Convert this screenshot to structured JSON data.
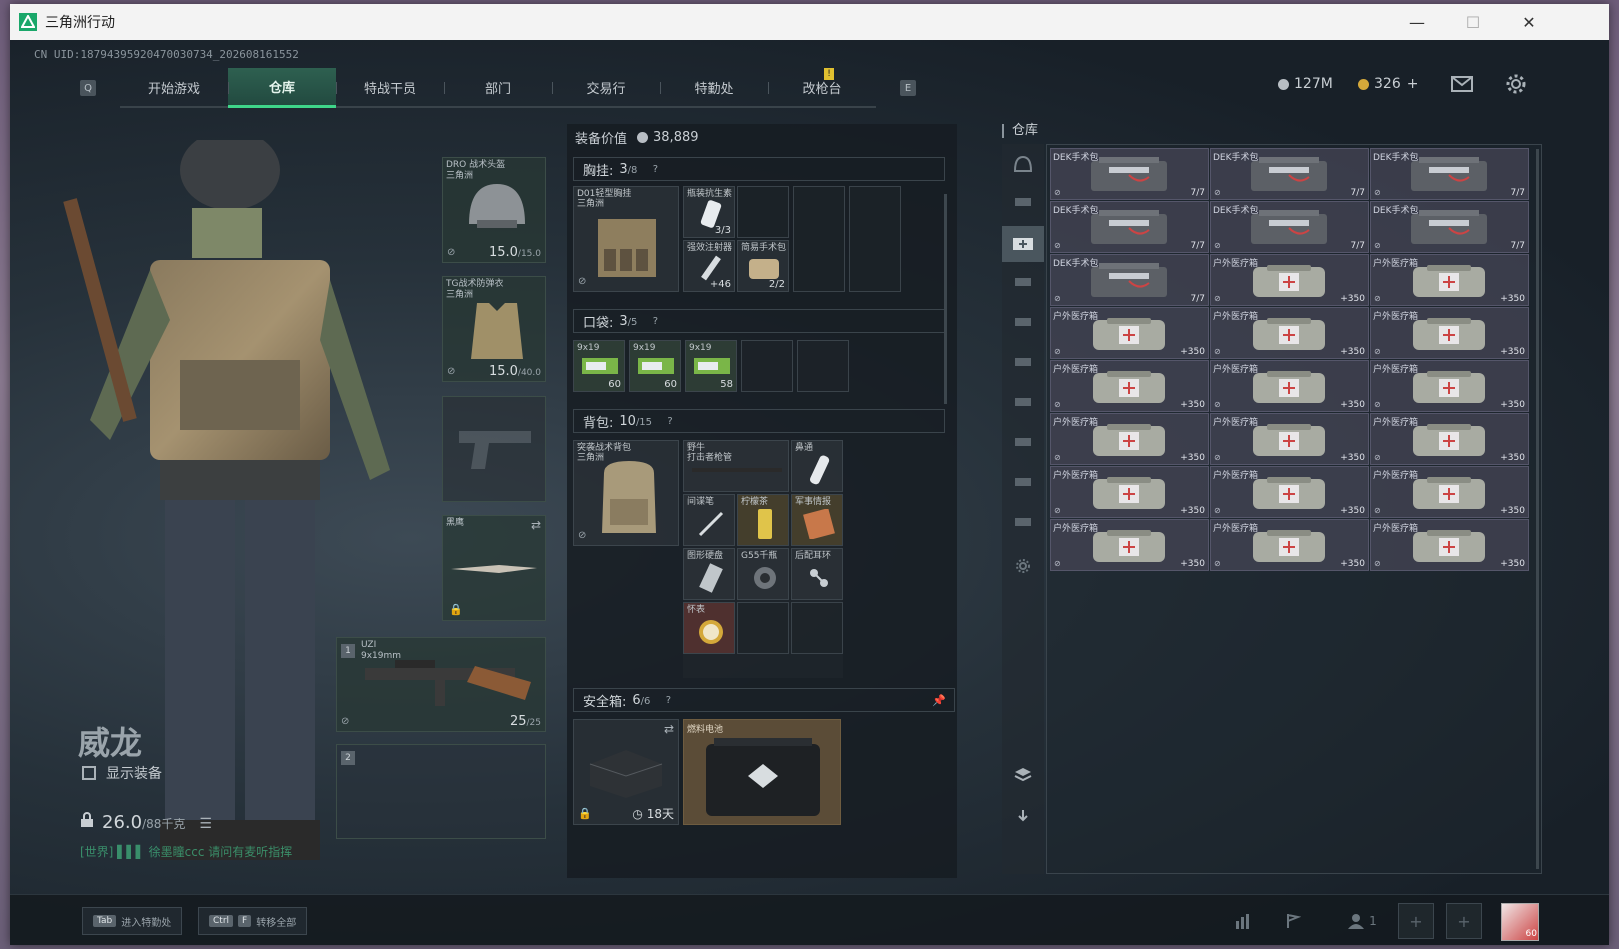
{
  "window": {
    "title": "三角洲行动",
    "minimize": "—",
    "maximize": "☐",
    "close": "✕"
  },
  "uid": "CN UID:18794395920470030734_20260816155​2",
  "nav": {
    "left_key": "Q",
    "right_key": "E",
    "tabs": [
      "开始游戏",
      "仓库",
      "特战干员",
      "部门",
      "交易行",
      "特勤处",
      "改枪台"
    ],
    "active_tab": "仓库",
    "badge": "!"
  },
  "currency": {
    "silver": "127M",
    "gold": "326",
    "gold_add": "+"
  },
  "operator": {
    "name": "威龙",
    "show_gear_label": "显示装备",
    "weight_value": "26.0",
    "weight_max": "/88千克",
    "chat": "[世界] ▌▌▌ 徐墨瞳ccc 请问有麦听指挥"
  },
  "equipment": {
    "helmet": {
      "name": "DRO 战术头盔\n三角洲",
      "dura": "15.0",
      "dura_max": "/15.0"
    },
    "armor": {
      "name": "TG战术防弹衣\n三角洲",
      "dura": "15.0",
      "dura_max": "/40.0"
    },
    "melee": {
      "name": "黑鹰"
    },
    "primary": {
      "slot": "1",
      "name": "UZI\n9x19mm",
      "ammo": "25",
      "ammo_max": "/25"
    },
    "secondary": {
      "slot": "2"
    }
  },
  "loadout": {
    "value_label": "装备价值",
    "value": "38,889",
    "chest": {
      "label": "胸挂:",
      "count": "3",
      "cap": "/8",
      "help": "?"
    },
    "pocket": {
      "label": "口袋:",
      "count": "3",
      "cap": "/5",
      "help": "?"
    },
    "backpack": {
      "label": "背包:",
      "count": "10",
      "cap": "/15",
      "help": "?"
    },
    "safebox": {
      "label": "安全箱:",
      "count": "6",
      "cap": "/6",
      "help": "?",
      "timer": "18天"
    },
    "chest_rig": {
      "name": "D01轻型胸挂\n三角洲"
    },
    "chest_items": [
      {
        "name": "瓶装抗生素",
        "qty": "3/3"
      },
      {
        "name": "强效注射器",
        "qty": "+46"
      },
      {
        "name": "简易手术包",
        "qty": "2/2"
      }
    ],
    "pocket_items": [
      {
        "name": "9x19",
        "qty": "60"
      },
      {
        "name": "9x19",
        "qty": "60"
      },
      {
        "name": "9x19",
        "qty": "58"
      }
    ],
    "backpack_bag": {
      "name": "突袭战术背包\n三角洲"
    },
    "backpack_items": [
      {
        "name": "野牛\n打击者枪管",
        "qty": ""
      },
      {
        "name": "鼻通",
        "qty": ""
      },
      {
        "name": "间谍笔",
        "qty": ""
      },
      {
        "name": "柠檬茶",
        "qty": ""
      },
      {
        "name": "军事情报",
        "qty": ""
      },
      {
        "name": "图形硬盘",
        "qty": ""
      },
      {
        "name": "G55千瓶",
        "qty": ""
      },
      {
        "name": "后配耳环",
        "qty": ""
      },
      {
        "name": "怀表",
        "qty": ""
      }
    ],
    "safebox_item": {
      "name": "燃料电池"
    }
  },
  "stash": {
    "label": "仓库",
    "items": [
      {
        "name": "DEK手术包",
        "qty": "7/7"
      },
      {
        "name": "DEK手术包",
        "qty": "7/7"
      },
      {
        "name": "DEK手术包",
        "qty": "7/7"
      },
      {
        "name": "DEK手术包",
        "qty": "7/7"
      },
      {
        "name": "DEK手术包",
        "qty": "7/7"
      },
      {
        "name": "DEK手术包",
        "qty": "7/7"
      },
      {
        "name": "DEK手术包",
        "qty": "7/7"
      },
      {
        "name": "户外医疗箱",
        "qty": "+350"
      },
      {
        "name": "户外医疗箱",
        "qty": "+350"
      },
      {
        "name": "户外医疗箱",
        "qty": "+350"
      },
      {
        "name": "户外医疗箱",
        "qty": "+350"
      },
      {
        "name": "户外医疗箱",
        "qty": "+350"
      },
      {
        "name": "户外医疗箱",
        "qty": "+350"
      },
      {
        "name": "户外医疗箱",
        "qty": "+350"
      },
      {
        "name": "户外医疗箱",
        "qty": "+350"
      },
      {
        "name": "户外医疗箱",
        "qty": "+350"
      },
      {
        "name": "户外医疗箱",
        "qty": "+350"
      },
      {
        "name": "户外医疗箱",
        "qty": "+350"
      },
      {
        "name": "户外医疗箱",
        "qty": "+350"
      },
      {
        "name": "户外医疗箱",
        "qty": "+350"
      },
      {
        "name": "户外医疗箱",
        "qty": "+350"
      },
      {
        "name": "户外医疗箱",
        "qty": "+350"
      },
      {
        "name": "户外医疗箱",
        "qty": "+350"
      },
      {
        "name": "户外医疗箱",
        "qty": "+350"
      }
    ]
  },
  "bottom": {
    "tab_key": "Tab",
    "tab_label": "进入特勤处",
    "ctrl_key": "Ctrl",
    "f_key": "F",
    "transfer_label": "转移全部",
    "squad_count": "1",
    "avatar_level": "60"
  },
  "colors": {
    "accent": "#3fd68a",
    "gold": "#d4a83a",
    "silver": "#b8bec4"
  }
}
